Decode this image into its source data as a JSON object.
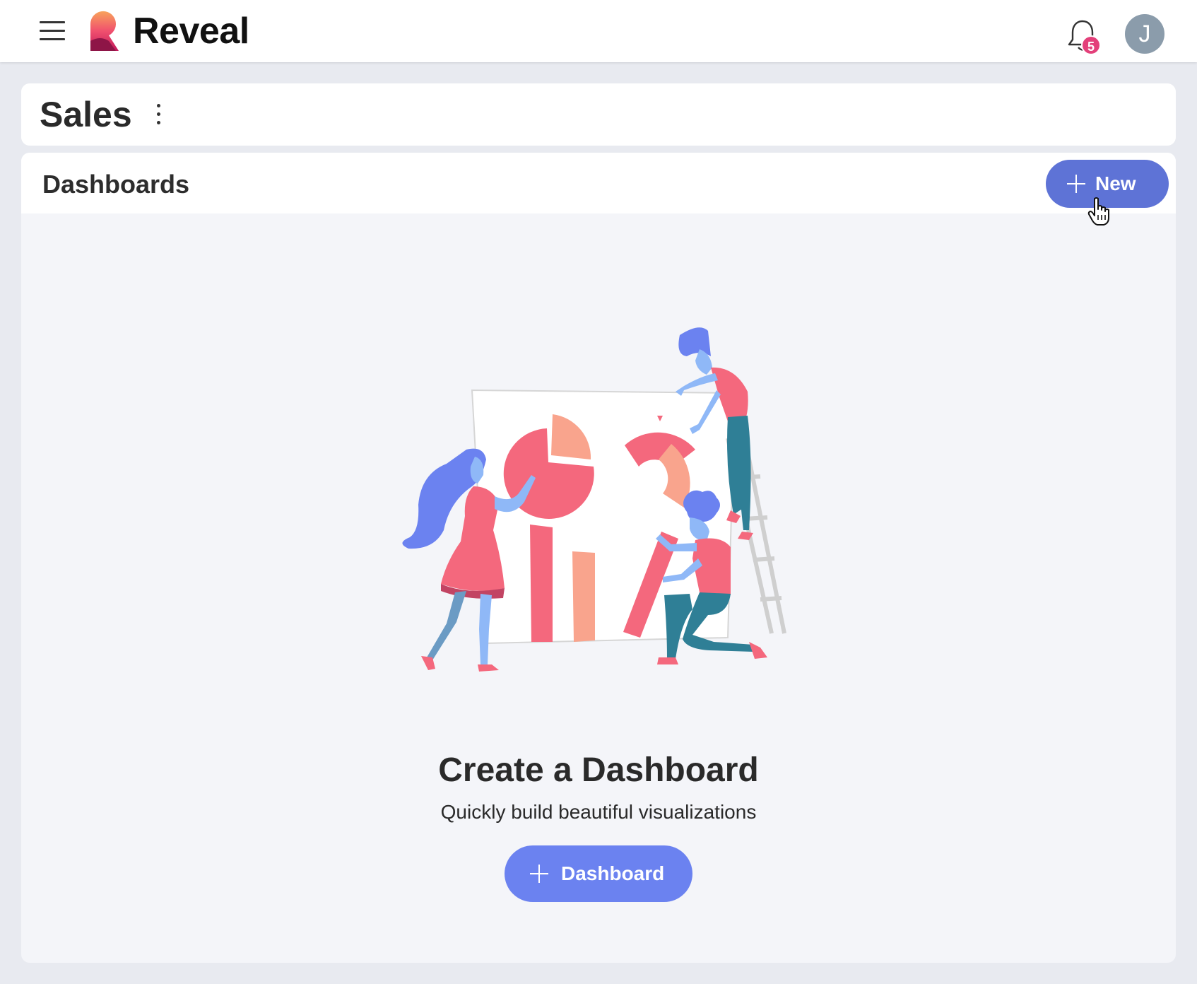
{
  "app": {
    "brand": "Reveal",
    "notifications_count": "5",
    "user_initial": "J"
  },
  "page": {
    "title": "Sales"
  },
  "section": {
    "title": "Dashboards",
    "new_button_label": "New"
  },
  "empty_state": {
    "title": "Create a Dashboard",
    "subtitle": "Quickly build beautiful visualizations",
    "button_label": "Dashboard"
  },
  "colors": {
    "primary": "#5e73d6",
    "primary_light": "#6b82f0",
    "badge": "#e3407a",
    "avatar": "#8b9cab",
    "background": "#e8eaf0"
  },
  "icons": [
    "menu-icon",
    "reveal-logo",
    "bell-icon",
    "avatar",
    "kebab-menu-icon",
    "plus-icon",
    "hand-cursor-icon"
  ]
}
